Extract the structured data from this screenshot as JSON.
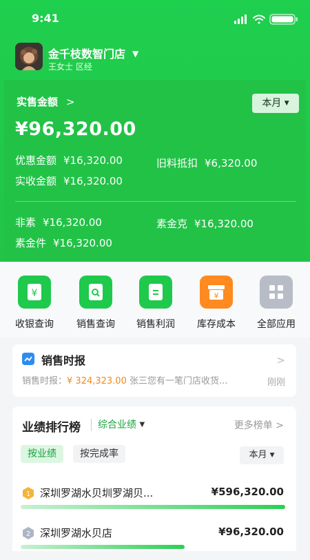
{
  "status": {
    "time": "9:41"
  },
  "store": {
    "name": "金千枝数智门店",
    "subtitle": "王女士 区经"
  },
  "sales": {
    "label": "实售金额",
    "period": "本月",
    "amount": "¥96,320.00",
    "items": [
      {
        "key": "优惠金额",
        "value": "¥16,320.00"
      },
      {
        "key": "旧料抵扣",
        "value": "¥6,320.00"
      },
      {
        "key": "实收金额",
        "value": "¥16,320.00"
      },
      {
        "key": "非素",
        "value": "¥16,320.00"
      },
      {
        "key": "素金克",
        "value": "¥16,320.00"
      },
      {
        "key": "素金件",
        "value": "¥16,320.00"
      }
    ]
  },
  "apps": [
    {
      "label": "收银查询",
      "icon": "cashier-icon",
      "color": "#1ec94c"
    },
    {
      "label": "销售查询",
      "icon": "sales-search-icon",
      "color": "#1ec94c"
    },
    {
      "label": "销售利润",
      "icon": "profit-icon",
      "color": "#1ec94c"
    },
    {
      "label": "库存成本",
      "icon": "inventory-icon",
      "color": "#ff8a1f"
    },
    {
      "label": "全部应用",
      "icon": "grid-icon",
      "color": "#b7bcc6"
    }
  ],
  "news": {
    "title": "销售时报",
    "prefix": "销售时报：",
    "amount": "¥ 324,323.00",
    "text": "张三您有一笔门店收货...",
    "time": "刚刚"
  },
  "ranking": {
    "title": "业绩排行榜",
    "tab": "综合业绩",
    "more": "更多榜单",
    "filters": [
      "按业绩",
      "按完成率"
    ],
    "period": "本月",
    "rows": [
      {
        "rank": "1",
        "name": "深圳罗湖水贝圳罗湖贝...",
        "value": "¥596,320.00",
        "progress": 1.0
      },
      {
        "rank": "2",
        "name": "深圳罗湖水贝店",
        "value": "¥96,320.00",
        "progress": 0.62
      }
    ]
  }
}
